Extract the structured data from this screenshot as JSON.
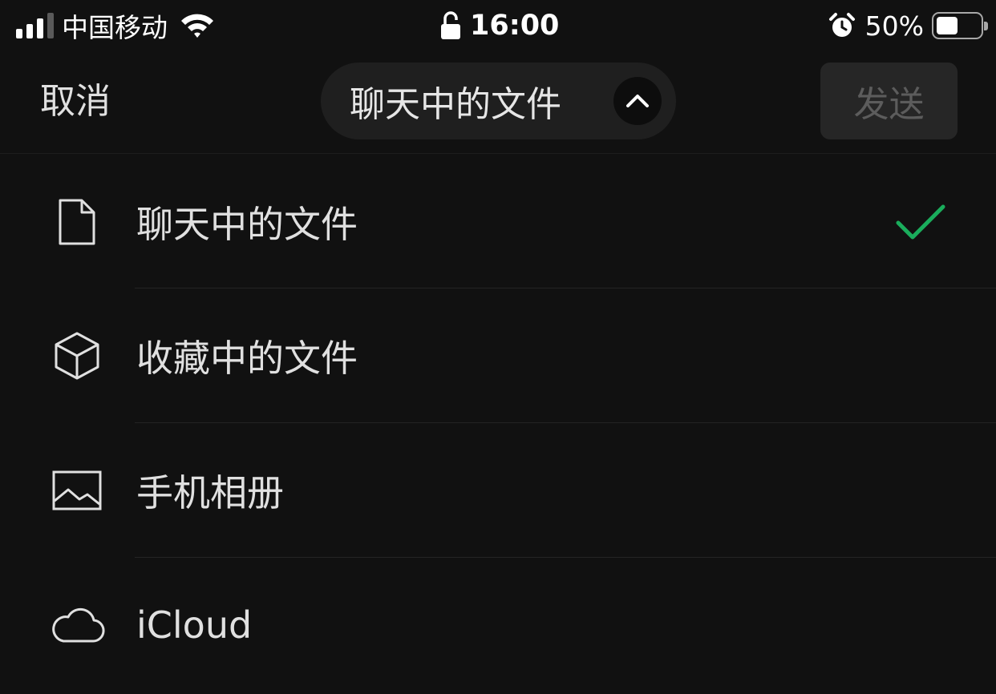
{
  "status_bar": {
    "carrier": "中国移动",
    "time": "16:00",
    "battery_percent": "50%",
    "battery_level": 0.5,
    "signal_bars_active": 3,
    "signal_bars_total": 4,
    "icons": [
      "signal-icon",
      "wifi-icon",
      "lock-icon",
      "alarm-icon",
      "battery-icon"
    ]
  },
  "nav": {
    "cancel_label": "取消",
    "title": "聊天中的文件",
    "title_icon": "chevron-up-icon",
    "send_label": "发送"
  },
  "menu": {
    "items": [
      {
        "label": "聊天中的文件",
        "icon": "document-icon",
        "selected": true
      },
      {
        "label": "收藏中的文件",
        "icon": "cube-icon",
        "selected": false
      },
      {
        "label": "手机相册",
        "icon": "image-icon",
        "selected": false
      },
      {
        "label": "iCloud",
        "icon": "cloud-icon",
        "selected": false
      }
    ],
    "check_icon": "checkmark-icon"
  },
  "colors": {
    "background": "#111111",
    "accent_green": "#1aad5c",
    "pill_background": "#1f1f1f",
    "send_disabled_background": "#262626",
    "send_disabled_text": "#5c5c5c"
  }
}
